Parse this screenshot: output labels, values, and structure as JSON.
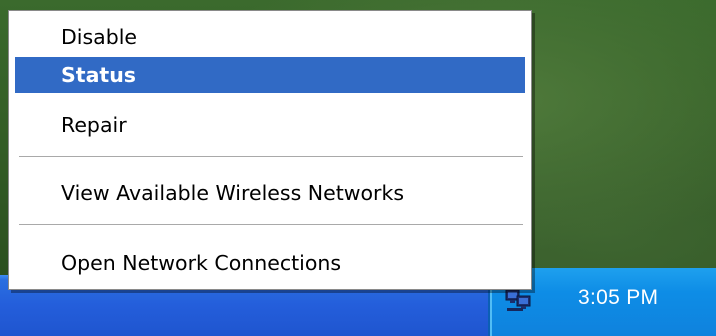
{
  "context_menu": {
    "items": [
      {
        "label": "Disable",
        "selected": false
      },
      {
        "label": "Status",
        "selected": true
      },
      {
        "label": "Repair",
        "selected": false
      },
      {
        "label": "View Available Wireless Networks",
        "selected": false
      },
      {
        "label": "Open Network Connections",
        "selected": false
      }
    ],
    "highlight_color": "#316ac5"
  },
  "taskbar": {
    "clock": "3:05 PM",
    "tray_icon": "network-connections-icon",
    "color": "#245edb",
    "tray_color": "#0f8de6"
  }
}
